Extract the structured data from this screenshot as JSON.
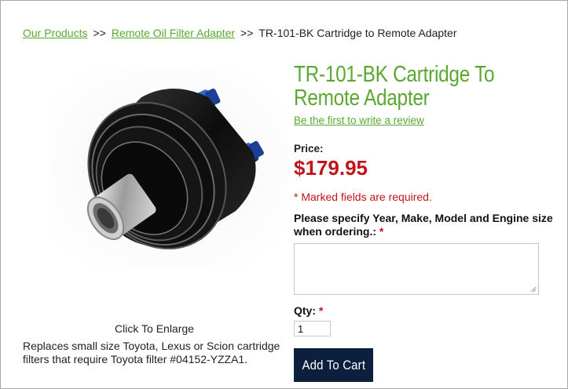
{
  "breadcrumb": {
    "items": [
      "Our Products",
      "Remote Oil Filter Adapter"
    ],
    "separator": ">>",
    "current": "TR-101-BK Cartridge to Remote Adapter"
  },
  "product": {
    "title": "TR-101-BK Cartridge To Remote Adapter",
    "review_link": "Be the first to write a review",
    "image_caption": "Click To Enlarge",
    "description": "Replaces small size Toyota, Lexus or Scion cartridge filters that require Toyota filter #04152-YZZA1.",
    "price_label": "Price:",
    "price": "$179.95"
  },
  "form": {
    "required_note": "* Marked fields are required.",
    "spec_label": "Please specify Year, Make, Model and Engine size when ordering.:",
    "required_marker": "*",
    "spec_value": "",
    "qty_label": "Qty:",
    "qty_value": "1",
    "add_to_cart_label": "Add To Cart"
  },
  "colors": {
    "link_green": "#5aa832",
    "price_red": "#c0141b",
    "button_navy": "#0c1f3f"
  }
}
